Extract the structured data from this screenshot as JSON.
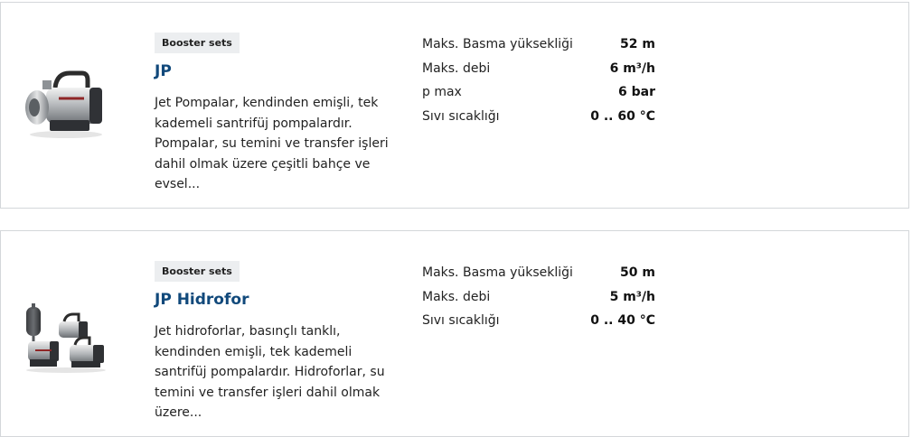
{
  "products": [
    {
      "category": "Booster sets",
      "title": "JP",
      "description": "Jet Pompalar, kendinden emişli, tek kademeli santrifüj pompalardır. Pompalar, su temini ve transfer işleri dahil olmak üzere çeşitli bahçe ve evsel...",
      "image_icon": "single-jet-pump-icon",
      "specs": [
        {
          "label": "Maks. Basma yüksekliği",
          "value": "52 m"
        },
        {
          "label": "Maks. debi",
          "value": "6 m³/h"
        },
        {
          "label": "p max",
          "value": "6 bar"
        },
        {
          "label": "Sıvı sıcaklığı",
          "value": "0 .. 60 °C"
        }
      ]
    },
    {
      "category": "Booster sets",
      "title": "JP Hidrofor",
      "description": "Jet hidroforlar, basınçlı tanklı, kendinden emişli, tek kademeli santrifüj pompalardır. Hidroforlar, su temini ve transfer işleri dahil olmak üzere...",
      "image_icon": "booster-set-with-tank-icon",
      "specs": [
        {
          "label": "Maks. Basma yüksekliği",
          "value": "50 m"
        },
        {
          "label": "Maks. debi",
          "value": "5 m³/h"
        },
        {
          "label": "Sıvı sıcaklığı",
          "value": "0 .. 40 °C"
        }
      ]
    }
  ]
}
